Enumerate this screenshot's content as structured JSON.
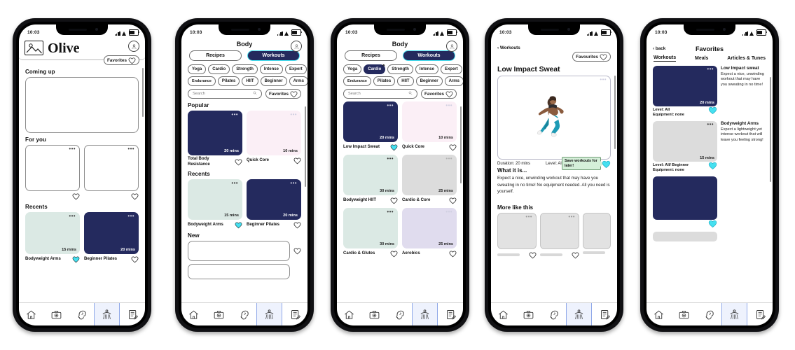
{
  "status_bar": {
    "time": "10:03"
  },
  "colors": {
    "navy": "#242a5e",
    "cyan": "#45e0f0",
    "mint": "#dbe9e4",
    "pink": "#fbeff6",
    "grey": "#dcdcdc",
    "lilac": "#e0dcee",
    "tooltip_green": "#d5efd9"
  },
  "screens": [
    {
      "id": "home",
      "brand": {
        "name": "Olive",
        "logo_icon": "image-icon",
        "avatar_icon": "person-icon"
      },
      "favorites_button": {
        "label": "Favorites",
        "icon": "heart-icon"
      },
      "sections": [
        {
          "title": "Coming up",
          "type": "banner"
        },
        {
          "title": "For you",
          "type": "two-cards",
          "cards": [
            {
              "title": "",
              "mins": "",
              "fill": "#ffffff",
              "favorited": false
            },
            {
              "title": "",
              "mins": "",
              "fill": "#ffffff",
              "favorited": false
            }
          ]
        },
        {
          "title": "Recents",
          "type": "two-cards",
          "cards": [
            {
              "title": "Bodyweight Arms",
              "mins": "15 mins",
              "fill": "#dbe9e4",
              "favorited": true
            },
            {
              "title": "Beginner Pilates",
              "mins": "20 mins",
              "fill": "#242a5e",
              "favorited": false
            }
          ]
        }
      ]
    },
    {
      "id": "body-workouts",
      "title": "Body",
      "avatar_icon": "person-icon",
      "toggles": [
        {
          "label": "Recipes",
          "active": false
        },
        {
          "label": "Workouts",
          "active": true
        }
      ],
      "chips_row1": [
        {
          "label": "Yoga",
          "state": "default"
        },
        {
          "label": "Cardio",
          "state": "bold"
        },
        {
          "label": "Strength",
          "state": "default"
        },
        {
          "label": "Intense",
          "state": "default"
        },
        {
          "label": "Expert",
          "state": "default"
        }
      ],
      "chips_row2": [
        {
          "label": "Endurance",
          "state": "default"
        },
        {
          "label": "Pilates",
          "state": "default"
        },
        {
          "label": "HIIT",
          "state": "default"
        },
        {
          "label": "Beginner",
          "state": "default"
        },
        {
          "label": "Arms",
          "state": "default"
        }
      ],
      "search": {
        "placeholder": "Search",
        "icon": "search-icon"
      },
      "favorites_button": {
        "label": "Favorites",
        "icon": "heart-icon"
      },
      "sections": [
        {
          "title": "Popular",
          "cards": [
            {
              "title": "Total Body Resistance",
              "mins": "20 mins",
              "fill": "#242a5e",
              "favorited": false
            },
            {
              "title": "Quick Core",
              "mins": "10 mins",
              "fill": "#fbeff6",
              "favorited": false
            }
          ]
        },
        {
          "title": "Recents",
          "cards": [
            {
              "title": "Bodyweight Arms",
              "mins": "15 mins",
              "fill": "#dbe9e4",
              "favorited": true
            },
            {
              "title": "Beginner Pilates",
              "mins": "20 mins",
              "fill": "#242a5e",
              "favorited": false
            }
          ]
        },
        {
          "title": "New",
          "cards": []
        }
      ]
    },
    {
      "id": "body-cardio-filter",
      "title": "Body",
      "avatar_icon": "person-icon",
      "toggles": [
        {
          "label": "Recipes",
          "active": false
        },
        {
          "label": "Workouts",
          "active": true
        }
      ],
      "chips_row1": [
        {
          "label": "Yoga",
          "state": "default"
        },
        {
          "label": "Cardio",
          "state": "selected",
          "remove_icon": "x-icon"
        },
        {
          "label": "Strength",
          "state": "default"
        },
        {
          "label": "Intense",
          "state": "default"
        },
        {
          "label": "Expert",
          "state": "default"
        }
      ],
      "chips_row2": [
        {
          "label": "Endurance",
          "state": "default"
        },
        {
          "label": "Pilates",
          "state": "default"
        },
        {
          "label": "HIIT",
          "state": "default"
        },
        {
          "label": "Beginner",
          "state": "default"
        },
        {
          "label": "Arms",
          "state": "default"
        }
      ],
      "search": {
        "placeholder": "Search",
        "icon": "search-icon"
      },
      "favorites_button": {
        "label": "Favorites",
        "icon": "heart-icon"
      },
      "results": [
        {
          "title": "Low Impact Sweat",
          "mins": "20 mins",
          "fill": "#242a5e",
          "favorited": true
        },
        {
          "title": "Quick Core",
          "mins": "10 mins",
          "fill": "#fbeff6",
          "favorited": false
        },
        {
          "title": "Bodyweight HIIT",
          "mins": "30 mins",
          "fill": "#dbe9e4",
          "favorited": false
        },
        {
          "title": "Cardio & Core",
          "mins": "25 mins",
          "fill": "#dcdcdc",
          "favorited": false
        },
        {
          "title": "Cardio & Glutes",
          "mins": "30 mins",
          "fill": "#dbe9e4",
          "favorited": false
        },
        {
          "title": "Aerobics",
          "mins": "25 mins",
          "fill": "#e0dcee",
          "favorited": false
        }
      ]
    },
    {
      "id": "workout-detail",
      "back_label": "Workouts",
      "favorites_button": {
        "label": "Favourites",
        "icon": "heart-icon"
      },
      "title": "Low Impact Sweat",
      "video": {
        "play_icon": "play-icon",
        "dots_icon": "more-icon"
      },
      "duration": "Duration: 20 mins",
      "level": "Level: All",
      "tooltip": "Save workouts for later!",
      "about_heading": "What it is...",
      "about_text": "Expect a nice, unwinding workout that may have you sweating in no time! No equipment needed. All you need is yourself.",
      "more_heading": "More like this",
      "more_cards": [
        {
          "favorited": false
        },
        {
          "favorited": false
        },
        {
          "favorited": false
        }
      ]
    },
    {
      "id": "favorites",
      "back_label": "back",
      "title": "Favorites",
      "tabs": [
        {
          "label": "Workouts",
          "active": true
        },
        {
          "label": "Meals",
          "active": false
        },
        {
          "label": "Articles & Tunes",
          "active": false
        }
      ],
      "items": [
        {
          "name": "Low Impact sweat",
          "description": "Expect a nice, unwinding workout that may have you sweating in no time!",
          "mins": "20 mins",
          "fill": "#242a5e",
          "level": "Level: All",
          "equipment": "Equipment: none",
          "favorited": true
        },
        {
          "name": "Bodyweight Arms",
          "description": "Expect a lightweight yet intense workout that will leave you feeling strong!",
          "mins": "15 mins",
          "fill": "#dcdcdc",
          "level": "Level: All/ Beginner",
          "equipment": "Equipment: none",
          "favorited": true
        },
        {
          "name": "",
          "description": "",
          "mins": "",
          "fill": "#242a5e",
          "level": "",
          "equipment": "",
          "favorited": true
        }
      ]
    }
  ],
  "nav": {
    "items": [
      {
        "icon": "home-icon",
        "active": false
      },
      {
        "icon": "medkit-icon",
        "active": false
      },
      {
        "icon": "mind-icon",
        "active": false
      },
      {
        "icon": "body-icon",
        "active": true
      },
      {
        "icon": "notes-icon",
        "active": false
      }
    ]
  }
}
